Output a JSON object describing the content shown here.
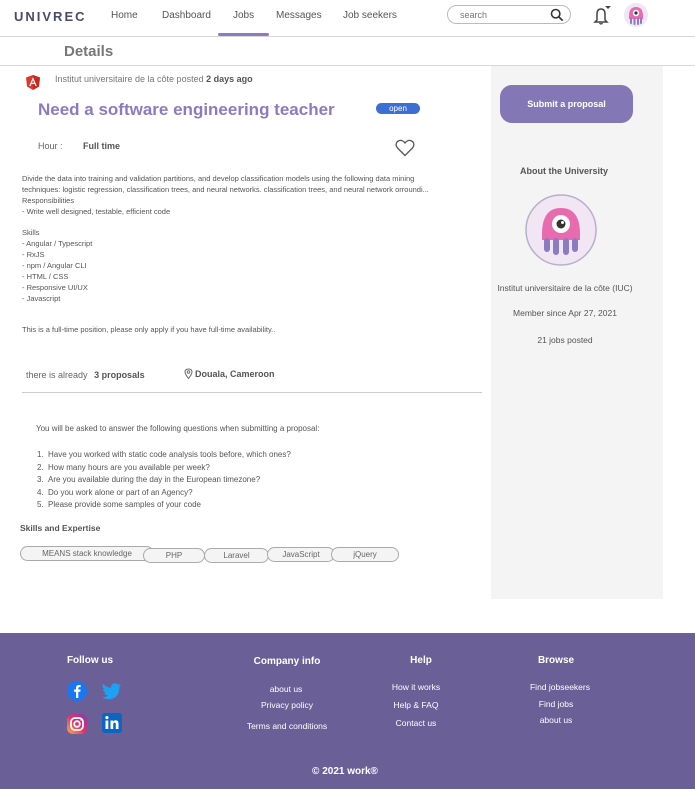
{
  "header": {
    "logo": "UNIVREC",
    "nav": [
      "Home",
      "Dashboard",
      "Jobs",
      "Messages",
      "Job seekers"
    ],
    "active_nav": "Jobs",
    "search": {
      "placeholder": "search"
    }
  },
  "page": {
    "title": "Details"
  },
  "job": {
    "poster": "Institut universitaire de la côte posted",
    "posted_ago": "2 days ago",
    "title": "Need a software engineering teacher",
    "status": "open",
    "hour_label": "Hour :",
    "hour_value": "Full time",
    "description": [
      "Divide the data into training and validation partitions, and develop classification models using the following data mining",
      "techniques: logistic regression, classification trees, and neural networks. classification trees, and neural network orroundi...",
      "Responsibilities",
      "- Write well designed, testable, efficient code",
      "",
      "Skills",
      "- Angular / Typescript",
      "- RxJS",
      "- npm / Angular CLI",
      "- HTML / CSS",
      "- Responsive UI/UX",
      "- Javascript",
      "",
      "",
      "This is a full-time position, please only apply if you have full-time availability.."
    ],
    "proposals_prefix": "there is already",
    "proposals_count": "3 proposals",
    "location": "Douala, Cameroon",
    "questions_intro": "You will be asked to answer the following questions when submitting a proposal:",
    "questions": [
      "Have you worked with static code analysis tools before, which ones?",
      "How many hours are you available per week?",
      "Are you available during the day in the European timezone?",
      "Do you work alone or part of an Agency?",
      "Please provide some samples of your code"
    ],
    "skills_title": "Skills and Expertise",
    "skills": [
      "MEANS stack knowledge",
      "PHP",
      "Laravel",
      "JavaScript",
      "jQuery"
    ]
  },
  "sidebar": {
    "submit_label": "Submit a proposal",
    "about_title": "About the University",
    "university_name": "Institut universitaire de la côte (IUC)",
    "member_since": "Member since Apr 27, 2021",
    "jobs_posted": "21 jobs posted"
  },
  "footer": {
    "follow_title": "Follow us",
    "company_title": "Company info",
    "company_links": [
      "about us",
      "Privacy policy",
      "Terms and conditions"
    ],
    "help_title": "Help",
    "help_links": [
      "How it works",
      "Help & FAQ",
      "Contact us"
    ],
    "browse_title": "Browse",
    "browse_links": [
      "Find jobseekers",
      "Find jobs",
      "about us"
    ],
    "copyright": "©  2021 work®"
  },
  "colors": {
    "accent": "#8a7bc2",
    "button": "#8378b5",
    "footer": "#6b5f98",
    "badge": "#3b6fd4"
  }
}
